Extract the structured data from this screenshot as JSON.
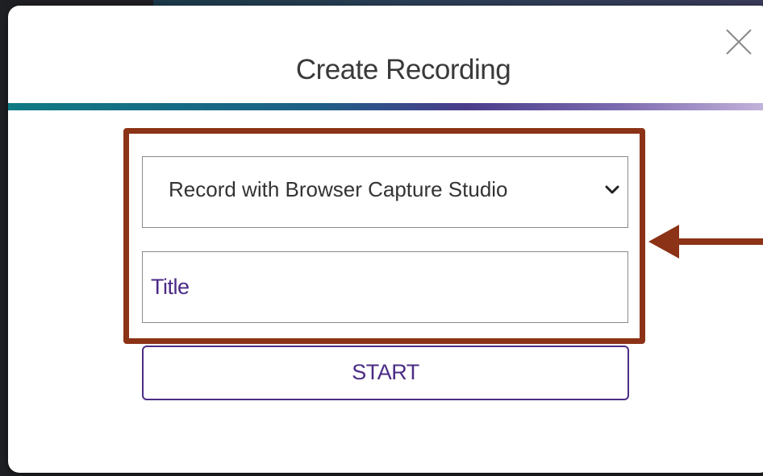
{
  "modal": {
    "title": "Create Recording",
    "close_icon": "close-icon"
  },
  "form": {
    "recording_method": {
      "selected": "Record with Browser Capture Studio",
      "icon": "chevron-down-icon"
    },
    "title_field": {
      "placeholder": "Title",
      "value": ""
    },
    "start_label": "START"
  },
  "colors": {
    "highlight_border": "#8b3217",
    "accent_purple": "#4b2c85",
    "header_gradient_start": "#0e7a83",
    "header_gradient_end": "#c6b6dc"
  }
}
